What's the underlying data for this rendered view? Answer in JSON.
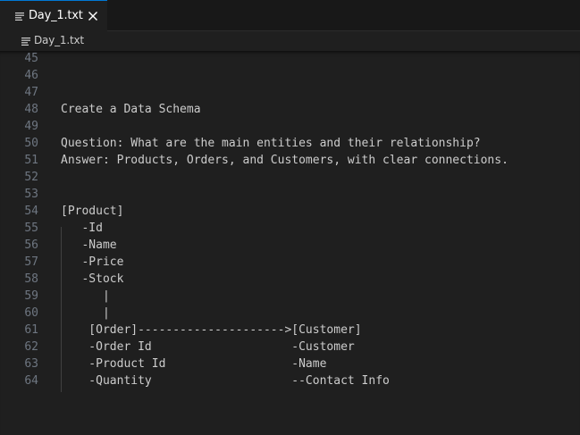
{
  "tab": {
    "label": "Day_1.txt",
    "file_icon": "text-file-icon",
    "close_icon": "close-icon"
  },
  "breadcrumb": {
    "label": "Day_1.txt",
    "file_icon": "text-file-icon"
  },
  "editor": {
    "lines": [
      {
        "num": "45",
        "text": ""
      },
      {
        "num": "46",
        "text": ""
      },
      {
        "num": "47",
        "text": ""
      },
      {
        "num": "48",
        "text": "Create a Data Schema"
      },
      {
        "num": "49",
        "text": ""
      },
      {
        "num": "50",
        "text": "Question: What are the main entities and their relationship?"
      },
      {
        "num": "51",
        "text": "Answer: Products, Orders, and Customers, with clear connections."
      },
      {
        "num": "52",
        "text": ""
      },
      {
        "num": "53",
        "text": ""
      },
      {
        "num": "54",
        "text": "[Product]"
      },
      {
        "num": "55",
        "text": "   -Id"
      },
      {
        "num": "56",
        "text": "   -Name"
      },
      {
        "num": "57",
        "text": "   -Price"
      },
      {
        "num": "58",
        "text": "   -Stock"
      },
      {
        "num": "59",
        "text": "      |"
      },
      {
        "num": "60",
        "text": "      |"
      },
      {
        "num": "61",
        "text": "    [Order]--------------------->[Customer]"
      },
      {
        "num": "62",
        "text": "    -Order Id                    -Customer"
      },
      {
        "num": "63",
        "text": "    -Product Id                  -Name"
      },
      {
        "num": "64",
        "text": "    -Quantity                    --Contact Info"
      }
    ]
  },
  "colors": {
    "background": "#1f1f1f",
    "tabbar": "#181818",
    "active_tab_border": "#0078d4",
    "line_number": "#6e7681",
    "text": "#cccccc"
  }
}
